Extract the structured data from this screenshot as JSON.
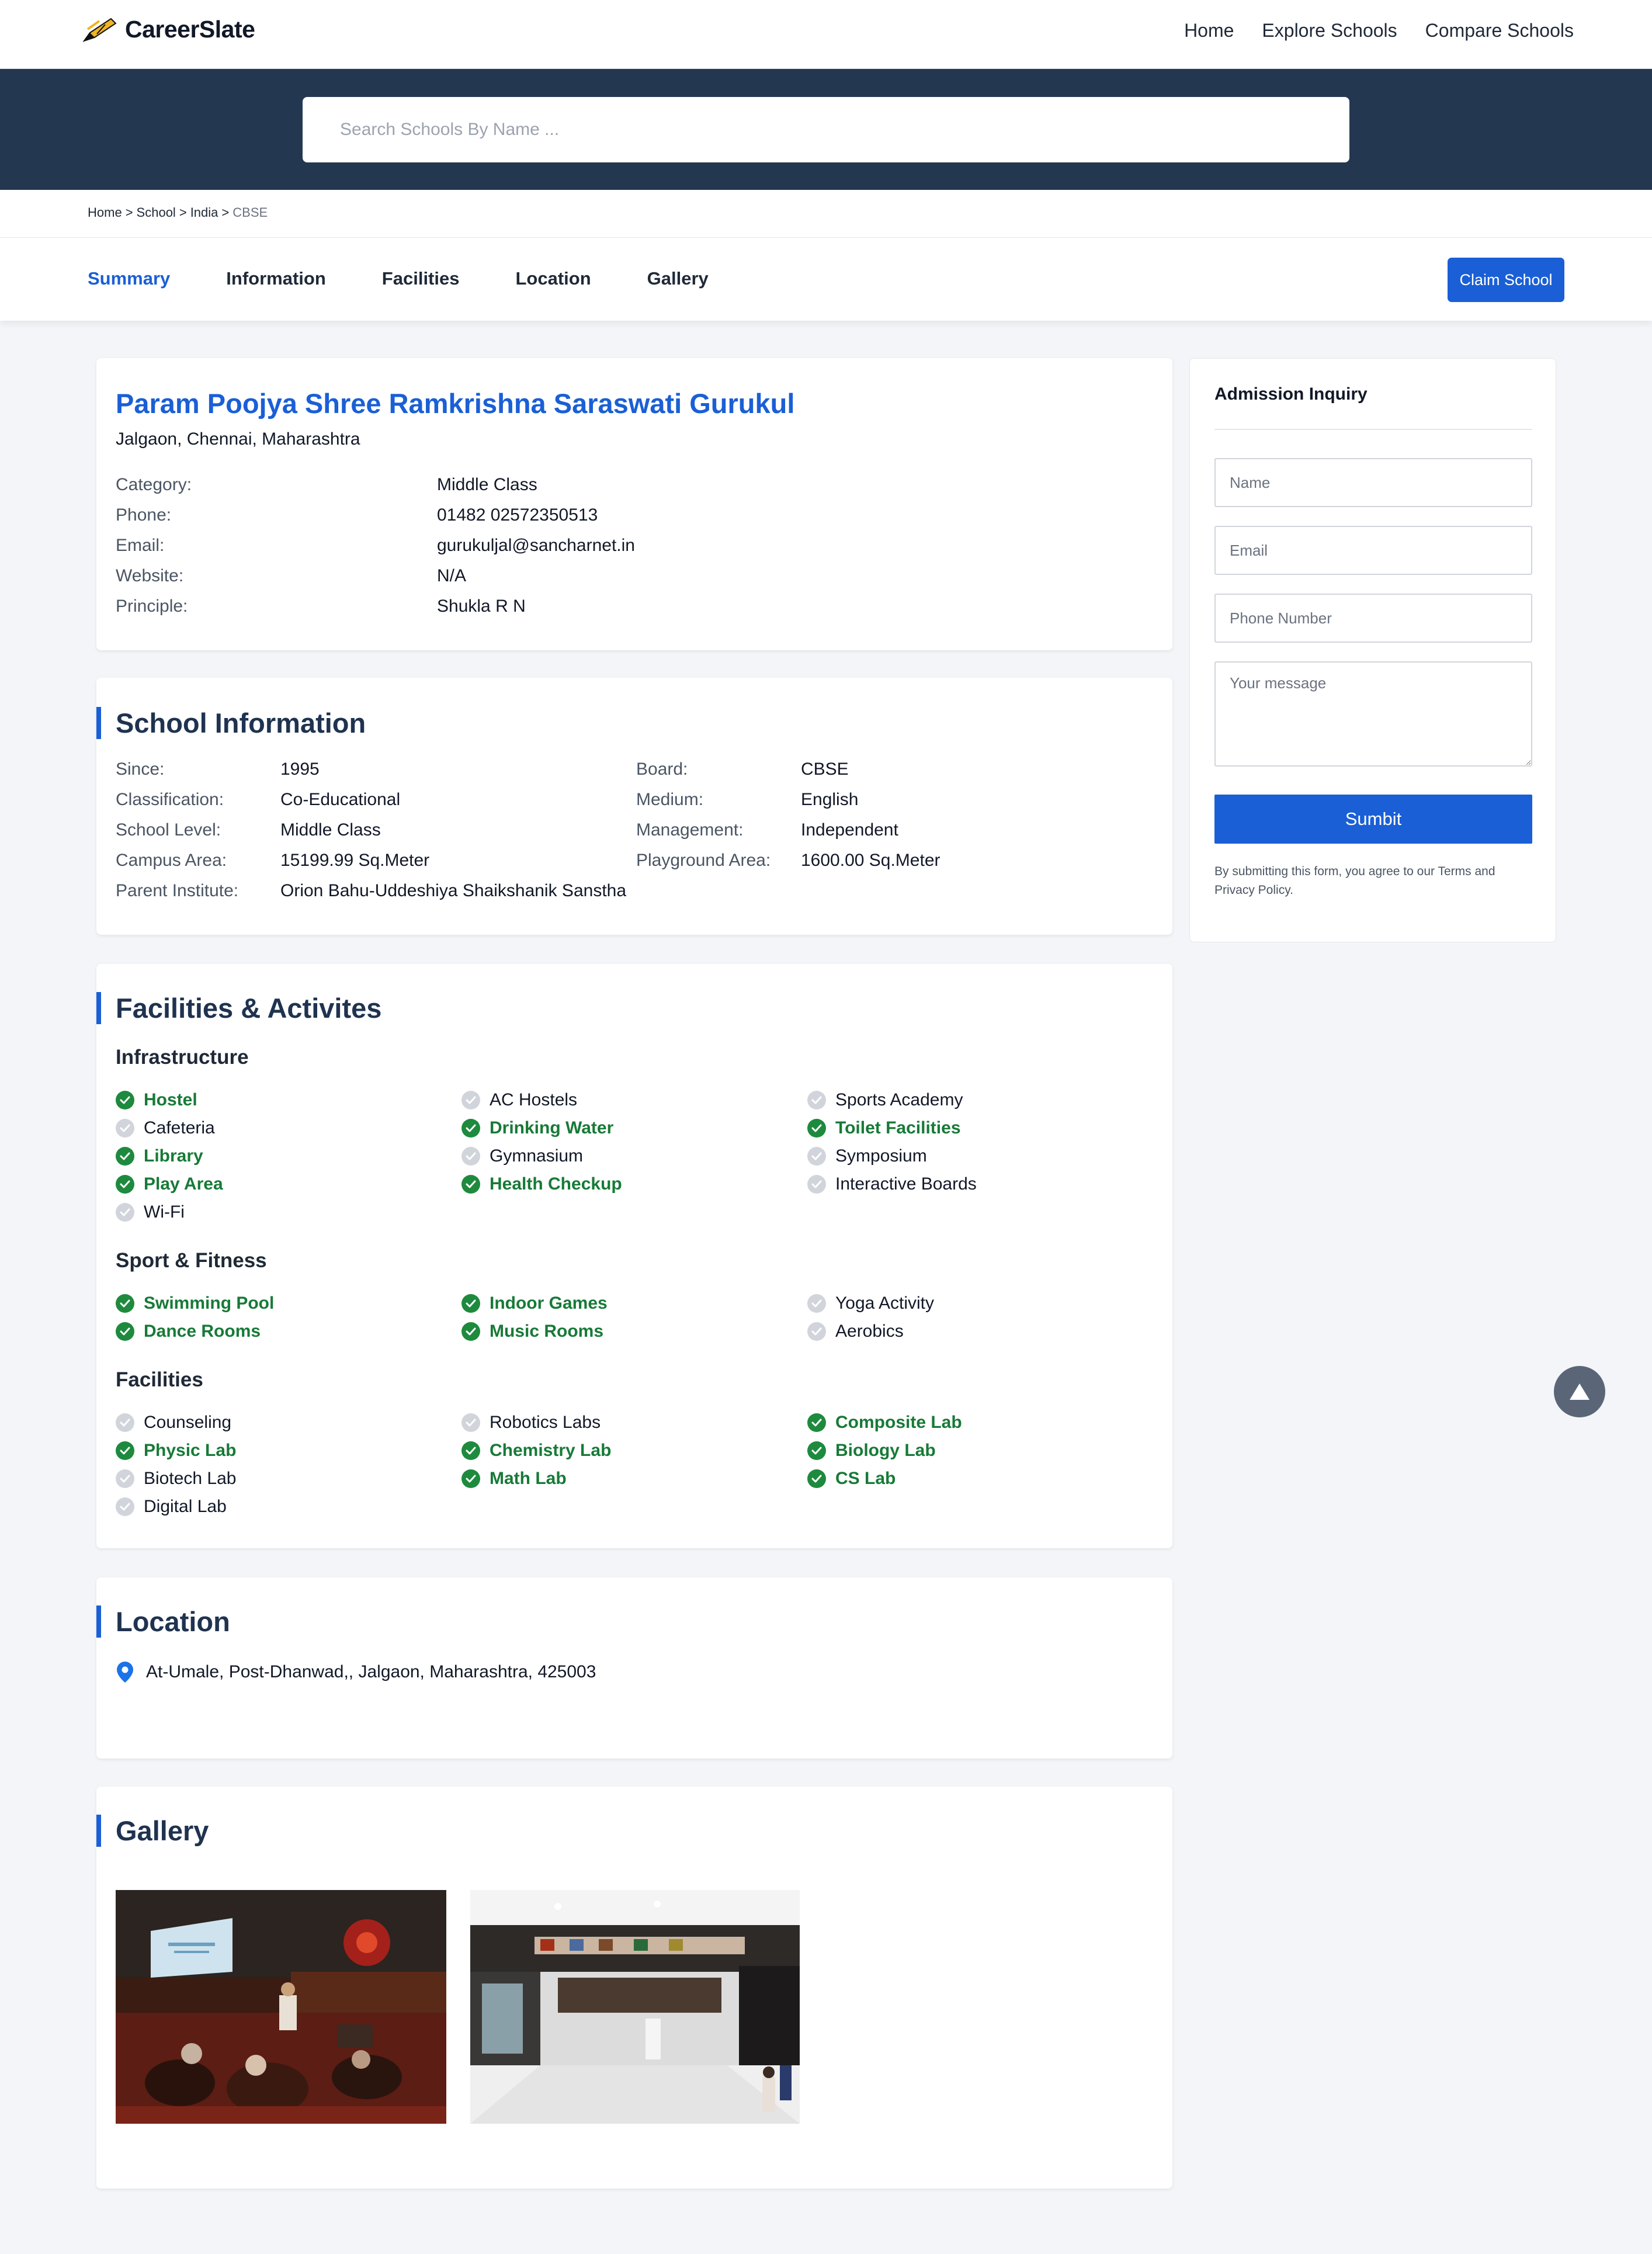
{
  "header": {
    "logo_text": "CareerSlate",
    "nav": [
      "Home",
      "Explore Schools",
      "Compare Schools"
    ]
  },
  "search": {
    "placeholder": "Search Schools By Name ..."
  },
  "breadcrumb": {
    "items": [
      "Home",
      "School",
      "India"
    ],
    "current": "CBSE",
    "separator": ">"
  },
  "tabs": {
    "items": [
      "Summary",
      "Information",
      "Facilities",
      "Location",
      "Gallery"
    ],
    "active": "Summary"
  },
  "claim_label": "Claim School",
  "summary": {
    "name": "Param Poojya Shree Ramkrishna Saraswati Gurukul",
    "location": "Jalgaon, Chennai, Maharashtra",
    "rows": [
      {
        "label": "Category:",
        "value": "Middle Class"
      },
      {
        "label": "Phone:",
        "value": "01482 02572350513"
      },
      {
        "label": "Email:",
        "value": "gurukuljal@sancharnet.in"
      },
      {
        "label": "Website:",
        "value": "N/A"
      },
      {
        "label": "Principle:",
        "value": "Shukla R N"
      }
    ]
  },
  "info": {
    "title": "School Information",
    "left": [
      {
        "label": "Since:",
        "value": "1995"
      },
      {
        "label": "Classification:",
        "value": "Co-Educational"
      },
      {
        "label": "School Level:",
        "value": "Middle Class"
      },
      {
        "label": "Campus Area:",
        "value": "15199.99 Sq.Meter"
      },
      {
        "label": "Parent Institute:",
        "value": "Orion Bahu-Uddeshiya Shaikshanik Sanstha"
      }
    ],
    "right": [
      {
        "label": "Board:",
        "value": "CBSE"
      },
      {
        "label": "Medium:",
        "value": "English"
      },
      {
        "label": "Management:",
        "value": "Independent"
      },
      {
        "label": "Playground Area:",
        "value": "1600.00 Sq.Meter"
      }
    ]
  },
  "facilities": {
    "title": "Facilities & Activites",
    "groups": [
      {
        "name": "Infrastructure",
        "items": [
          {
            "label": "Hostel",
            "available": true
          },
          {
            "label": "AC Hostels",
            "available": false
          },
          {
            "label": "Sports Academy",
            "available": false
          },
          {
            "label": "Cafeteria",
            "available": false
          },
          {
            "label": "Drinking Water",
            "available": true
          },
          {
            "label": "Toilet Facilities",
            "available": true
          },
          {
            "label": "Library",
            "available": true
          },
          {
            "label": "Gymnasium",
            "available": false
          },
          {
            "label": "Symposium",
            "available": false
          },
          {
            "label": "Play Area",
            "available": true
          },
          {
            "label": "Health Checkup",
            "available": true
          },
          {
            "label": "Interactive Boards",
            "available": false
          },
          {
            "label": "Wi-Fi",
            "available": false
          }
        ]
      },
      {
        "name": "Sport & Fitness",
        "items": [
          {
            "label": "Swimming Pool",
            "available": true
          },
          {
            "label": "Indoor Games",
            "available": true
          },
          {
            "label": "Yoga Activity",
            "available": false
          },
          {
            "label": "Dance Rooms",
            "available": true
          },
          {
            "label": "Music Rooms",
            "available": true
          },
          {
            "label": "Aerobics",
            "available": false
          }
        ]
      },
      {
        "name": "Facilities",
        "items": [
          {
            "label": "Counseling",
            "available": false
          },
          {
            "label": "Robotics Labs",
            "available": false
          },
          {
            "label": "Composite Lab",
            "available": true
          },
          {
            "label": "Physic Lab",
            "available": true
          },
          {
            "label": "Chemistry Lab",
            "available": true
          },
          {
            "label": "Biology Lab",
            "available": true
          },
          {
            "label": "Biotech Lab",
            "available": false
          },
          {
            "label": "Math Lab",
            "available": true
          },
          {
            "label": "CS Lab",
            "available": true
          },
          {
            "label": "Digital Lab",
            "available": false
          }
        ]
      }
    ]
  },
  "location": {
    "title": "Location",
    "address": "At-Umale, Post-Dhanwad,, Jalgaon, Maharashtra, 425003"
  },
  "gallery": {
    "title": "Gallery"
  },
  "inquiry": {
    "title": "Admission Inquiry",
    "name_placeholder": "Name",
    "email_placeholder": "Email",
    "phone_placeholder": "Phone Number",
    "message_placeholder": "Your message",
    "submit": "Sumbit",
    "note": "By submitting this form, you agree to our Terms and Privacy Policy."
  },
  "colors": {
    "accent": "#1a5fd6",
    "hero": "#243751",
    "available": "#177a37",
    "unavailable": "#d1d5db"
  }
}
